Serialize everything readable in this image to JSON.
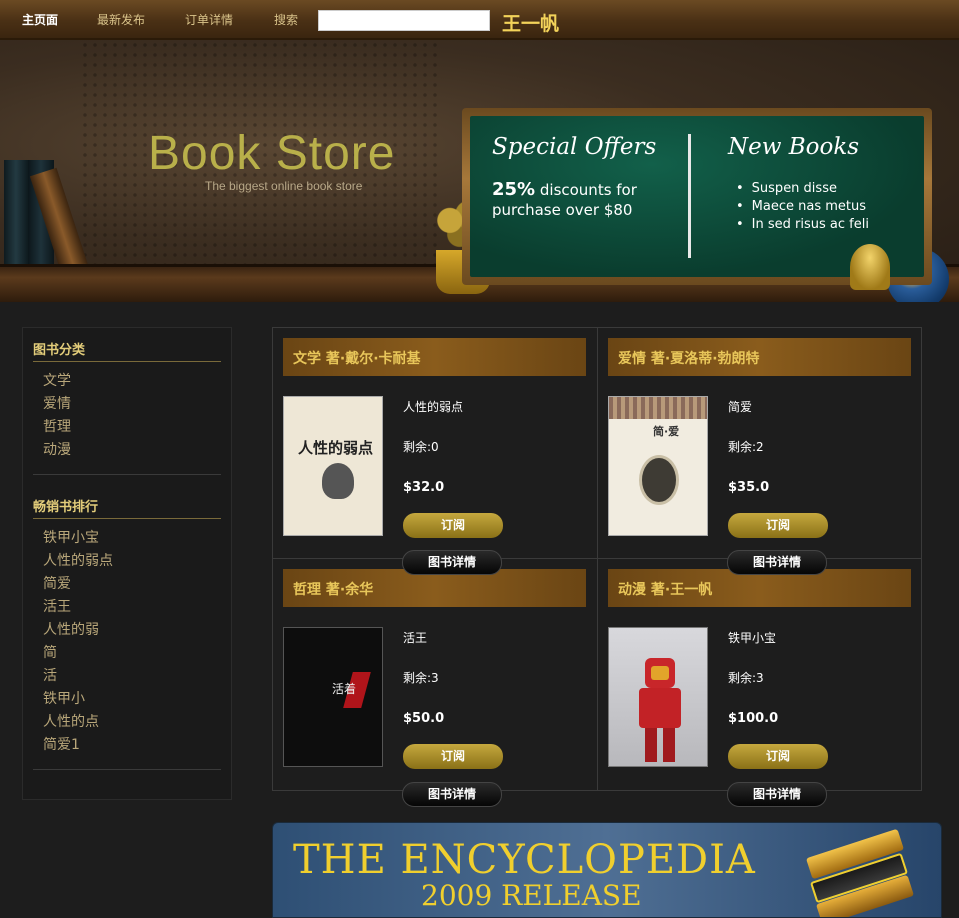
{
  "nav": {
    "items": [
      "主页面",
      "最新发布",
      "订单详情",
      "搜索"
    ],
    "search_placeholder": "",
    "username": "王一帆"
  },
  "header": {
    "brand_title": "Book Store",
    "brand_subtitle": "The biggest online book store",
    "special_offers": {
      "title": "Special Offers",
      "discount": "25%",
      "text": "discounts for purchase over $80"
    },
    "new_books": {
      "title": "New Books",
      "items": [
        "Suspen disse",
        "Maece nas metus",
        "In sed risus ac feli"
      ]
    }
  },
  "sidebar": {
    "categories_title": "图书分类",
    "categories": [
      "文学",
      "爱情",
      "哲理",
      "动漫"
    ],
    "bestsellers_title": "畅销书排行",
    "bestsellers": [
      "铁甲小宝",
      "人性的弱点",
      "简爱",
      "活王",
      "人性的弱",
      "简",
      "活",
      "铁甲小",
      "人性的点",
      "简爱1"
    ]
  },
  "products": [
    {
      "header": "文学 著·戴尔·卡耐基",
      "name": "人性的弱点",
      "stock": "剩余:0",
      "price": "$32.0",
      "order_label": "订阅",
      "detail_label": "图书详情",
      "cover_title": "人性的弱点"
    },
    {
      "header": "爱情 著·夏洛蒂·勃朗特",
      "name": "简爱",
      "stock": "剩余:2",
      "price": "$35.0",
      "order_label": "订阅",
      "detail_label": "图书详情",
      "cover_title": "简·爱"
    },
    {
      "header": "哲理 著·余华",
      "name": "活王",
      "stock": "剩余:3",
      "price": "$50.0",
      "order_label": "订阅",
      "detail_label": "图书详情",
      "cover_title": "活着"
    },
    {
      "header": "动漫 著·王一帆",
      "name": "铁甲小宝",
      "stock": "剩余:3",
      "price": "$100.0",
      "order_label": "订阅",
      "detail_label": "图书详情",
      "cover_title": ""
    }
  ],
  "banner": {
    "title": "THE ENCYCLOPEDIA",
    "subtitle": "2009 RELEASE"
  }
}
